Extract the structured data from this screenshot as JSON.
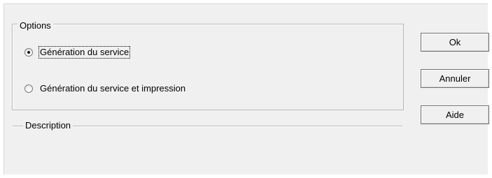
{
  "options_group": {
    "title": "Options",
    "choices": [
      {
        "label": "Génération du service",
        "selected": true
      },
      {
        "label": "Génération du service et impression",
        "selected": false
      }
    ]
  },
  "description_group": {
    "title": "Description"
  },
  "buttons": {
    "ok": "Ok",
    "cancel": "Annuler",
    "help": "Aide"
  }
}
